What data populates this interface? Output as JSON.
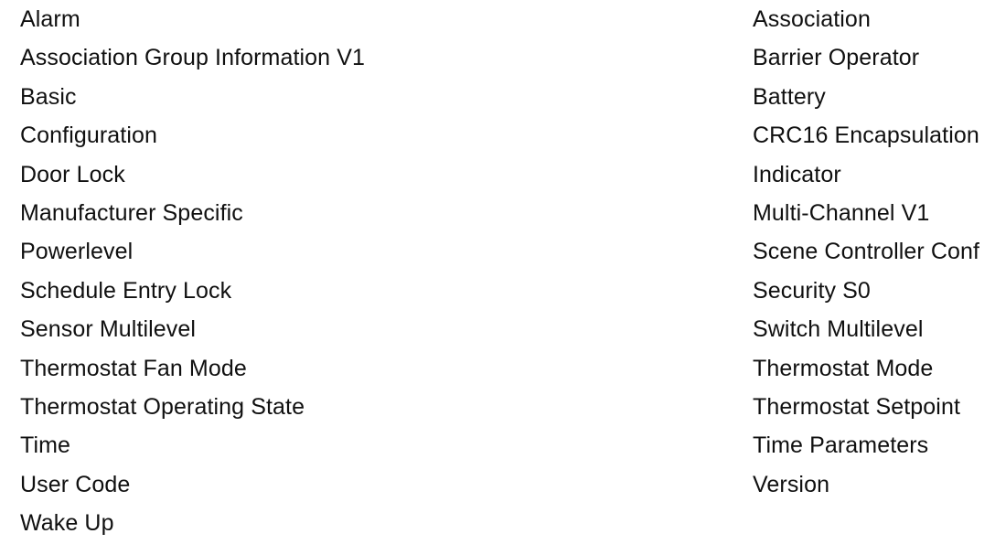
{
  "page": {
    "background_color": "#ffffff",
    "text_color": "#101010",
    "layout": "two-column-list"
  },
  "command_classes": {
    "left_column": [
      {
        "label": "Alarm"
      },
      {
        "label": "Association Group Information V1"
      },
      {
        "label": "Basic"
      },
      {
        "label": "Configuration"
      },
      {
        "label": "Door Lock"
      },
      {
        "label": "Manufacturer Specific"
      },
      {
        "label": "Powerlevel"
      },
      {
        "label": "Schedule Entry Lock"
      },
      {
        "label": "Sensor Multilevel"
      },
      {
        "label": "Thermostat Fan Mode"
      },
      {
        "label": "Thermostat Operating State"
      },
      {
        "label": "Time"
      },
      {
        "label": "User Code"
      },
      {
        "label": "Wake Up"
      }
    ],
    "right_column": [
      {
        "label": "Association"
      },
      {
        "label": "Barrier Operator"
      },
      {
        "label": "Battery"
      },
      {
        "label": "CRC16 Encapsulation"
      },
      {
        "label": "Indicator"
      },
      {
        "label": "Multi-Channel V1"
      },
      {
        "label": "Scene Controller Conf"
      },
      {
        "label": "Security S0"
      },
      {
        "label": "Switch Multilevel"
      },
      {
        "label": "Thermostat Mode"
      },
      {
        "label": "Thermostat Setpoint"
      },
      {
        "label": "Time Parameters"
      },
      {
        "label": "Version"
      }
    ]
  }
}
